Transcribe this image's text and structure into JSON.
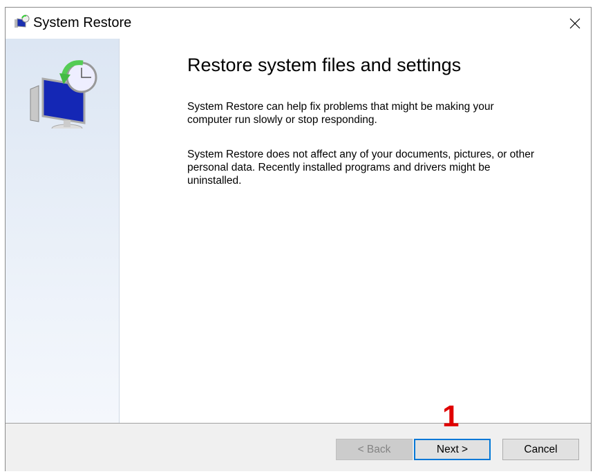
{
  "window": {
    "title": "System Restore",
    "app_icon": "system-restore-icon",
    "close_icon": "close-icon"
  },
  "main": {
    "heading": "Restore system files and settings",
    "paragraph1_line1": "System Restore can help fix problems that might be making your",
    "paragraph1_line2": "computer run slowly or stop responding.",
    "paragraph2_line1": "System Restore does not affect any of your documents, pictures, or other",
    "paragraph2_line2": "personal data. Recently installed programs and drivers might be",
    "paragraph2_line3": "uninstalled."
  },
  "footer": {
    "back_label": "< Back",
    "next_label": "Next >",
    "cancel_label": "Cancel"
  },
  "annotation": {
    "step_number": "1",
    "color": "#e00000"
  }
}
